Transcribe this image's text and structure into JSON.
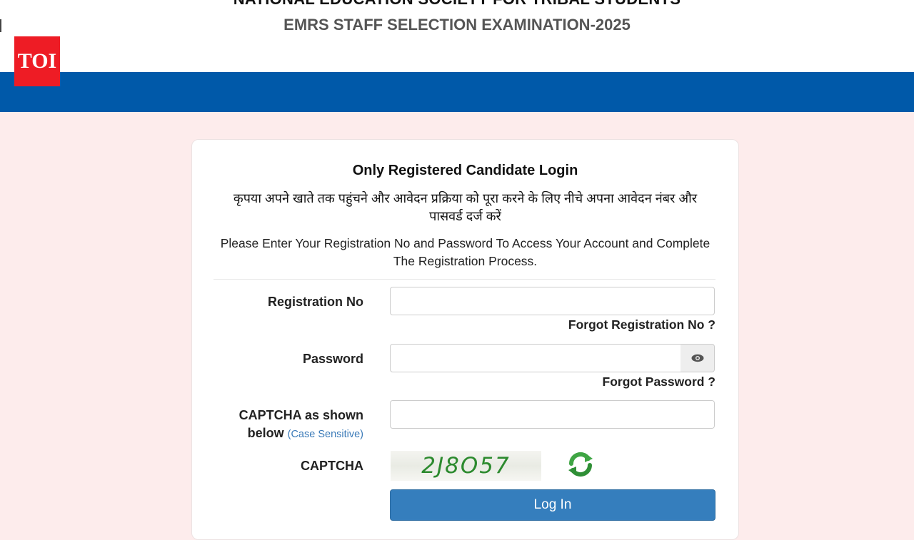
{
  "header": {
    "org_title": "NATIONAL EDUCATION SOCIETY FOR TRIBAL STUDENTS",
    "exam_title": "EMRS STAFF SELECTION EXAMINATION-2025",
    "logo_text": "TOI"
  },
  "login": {
    "title": "Only Registered Candidate Login",
    "hindi_instruction": "कृपया अपने खाते तक पहुंचने और आवेदन प्रक्रिया को पूरा करने के लिए नीचे अपना आवेदन नंबर और पासवर्ड दर्ज करें",
    "english_instruction": "Please Enter Your Registration No and Password To Access Your Account and Complete The Registration Process.",
    "registration_label": "Registration No",
    "registration_value": "",
    "forgot_registration": "Forgot Registration No ?",
    "password_label": "Password",
    "password_value": "",
    "forgot_password": "Forgot Password ?",
    "captcha_label": "CAPTCHA as shown below",
    "captcha_label_main": "CAPTCHA as shown below",
    "captcha_hint": "(Case Sensitive)",
    "captcha_value": "",
    "captcha_image_label": "CAPTCHA",
    "captcha_code": "2J8O57",
    "login_button": "Log In"
  },
  "colors": {
    "band_blue": "#0059a9",
    "page_bg": "#fdecec",
    "button_blue": "#357ebd",
    "logo_red": "#ee1c25",
    "captcha_green": "#2c8a2e"
  },
  "icons": {
    "show_password": "eye-icon",
    "refresh_captcha": "refresh-icon"
  }
}
